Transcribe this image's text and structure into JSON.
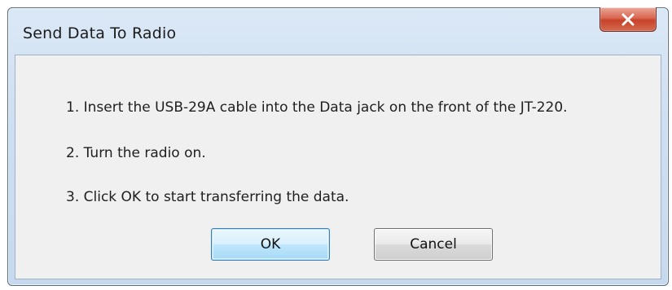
{
  "dialog": {
    "title": "Send Data To Radio",
    "close_icon": "close-icon",
    "steps": [
      "1. Insert the USB-29A cable into the Data jack on the front of the JT-220.",
      "2. Turn the radio on.",
      "3. Click OK to start transferring the data."
    ],
    "buttons": {
      "ok_label": "OK",
      "cancel_label": "Cancel"
    },
    "colors": {
      "close_button": "#c6422a",
      "default_button_border": "#3c7fb1"
    }
  }
}
